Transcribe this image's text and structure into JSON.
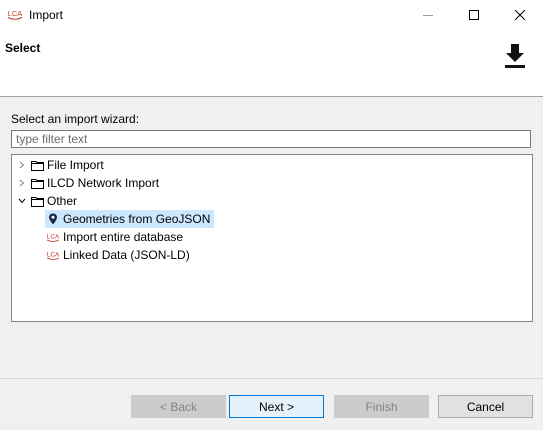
{
  "window": {
    "title": "Import",
    "app_icon_text": "LCA",
    "controls": {
      "minimize": "minimize",
      "maximize": "maximize",
      "close": "close"
    }
  },
  "header": {
    "title": "Select",
    "icon": "download-icon"
  },
  "content": {
    "wizard_label": "Select an import wizard:",
    "filter": {
      "value": "",
      "placeholder": "type filter text"
    },
    "tree": [
      {
        "label": "File Import",
        "expanded": false,
        "icon": "folder-icon",
        "level": 0
      },
      {
        "label": "ILCD Network Import",
        "expanded": false,
        "icon": "folder-icon",
        "level": 0
      },
      {
        "label": "Other",
        "expanded": true,
        "icon": "folder-icon",
        "level": 0
      },
      {
        "label": "Geometries from GeoJSON",
        "icon": "map-pin-icon",
        "level": 1,
        "selected": true
      },
      {
        "label": "Import entire database",
        "icon": "lca-icon",
        "level": 1
      },
      {
        "label": "Linked Data (JSON-LD)",
        "icon": "lca-icon",
        "level": 1
      }
    ]
  },
  "buttons": {
    "back": "< Back",
    "next": "Next >",
    "finish": "Finish",
    "cancel": "Cancel"
  },
  "colors": {
    "selection": "#cce8ff",
    "accent": "#0078d7",
    "lca_icon": "#c0392b"
  }
}
